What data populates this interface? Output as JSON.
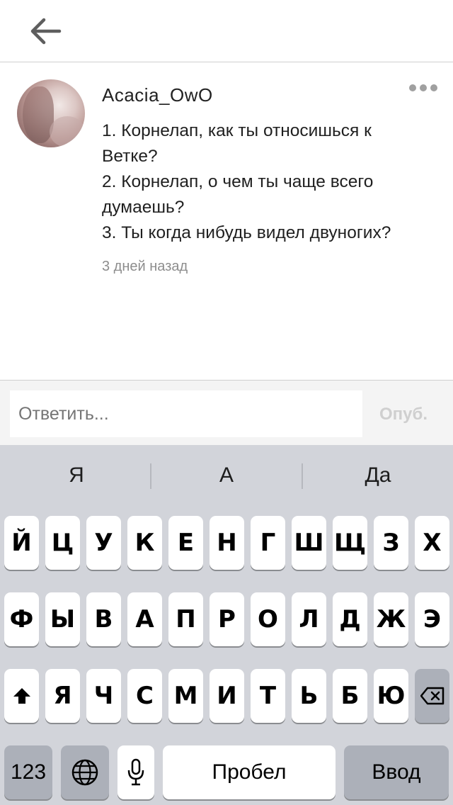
{
  "header": {
    "back_icon": "arrow-left-icon"
  },
  "comment": {
    "username": "Acacia_OwO",
    "lines": [
      "1. Корнелап, как ты относишься к",
      "Ветке?",
      "2. Корнелап, о чем ты чаще всего",
      "думаешь?",
      "3. Ты когда нибудь видел двуногих?"
    ],
    "time": "3 дней назад",
    "more_icon": "more-horizontal-icon"
  },
  "reply": {
    "placeholder": "Ответить...",
    "publish_label": "Опуб."
  },
  "keyboard": {
    "suggestions": [
      "Я",
      "А",
      "Да"
    ],
    "row1": [
      "Й",
      "Ц",
      "У",
      "К",
      "Е",
      "Н",
      "Г",
      "Ш",
      "Щ",
      "З",
      "Х"
    ],
    "row2": [
      "Ф",
      "Ы",
      "В",
      "А",
      "П",
      "Р",
      "О",
      "Л",
      "Д",
      "Ж",
      "Э"
    ],
    "row3": [
      "Я",
      "Ч",
      "С",
      "М",
      "И",
      "Т",
      "Ь",
      "Б",
      "Ю"
    ],
    "numbers_label": "123",
    "space_label": "Пробел",
    "return_label": "Ввод",
    "icons": {
      "shift": "shift-icon",
      "backspace": "backspace-icon",
      "globe": "globe-icon",
      "mic": "microphone-icon"
    }
  }
}
